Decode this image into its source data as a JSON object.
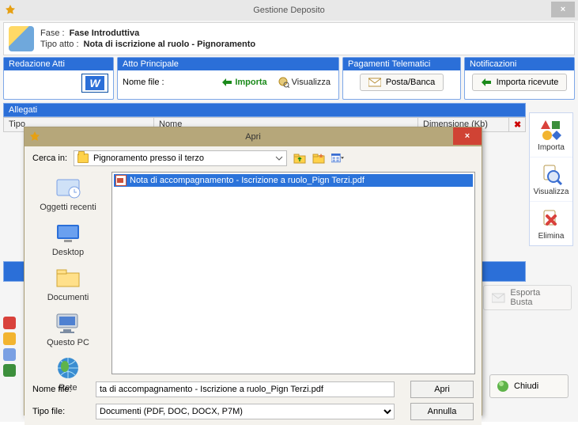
{
  "window": {
    "title": "Gestione Deposito",
    "close_glyph": "×"
  },
  "header": {
    "fase_label": "Fase :",
    "fase_value": "Fase Introduttiva",
    "tipo_label": "Tipo atto :",
    "tipo_value": "Nota di iscrizione al ruolo - Pignoramento"
  },
  "groups": {
    "redazione": {
      "title": "Redazione Atti"
    },
    "atto": {
      "title": "Atto Principale",
      "nome_file_label": "Nome file :",
      "importa_label": "Importa",
      "visualizza_label": "Visualizza"
    },
    "pagamenti": {
      "title": "Pagamenti Telematici",
      "button_label": "Posta/Banca"
    },
    "notificazioni": {
      "title": "Notificazioni",
      "button_label": "Importa ricevute"
    }
  },
  "allegati": {
    "section_title": "Allegati",
    "columns": {
      "tipo": "Tipo",
      "nome": "Nome",
      "dimensione": "Dimensione (Kb)",
      "del": "✖"
    }
  },
  "side": {
    "importa": "Importa",
    "visualizza": "Visualizza",
    "elimina": "Elimina"
  },
  "esporta_label": "Esporta Busta",
  "chiudi_label": "Chiudi",
  "dialog": {
    "title": "Apri",
    "close_glyph": "×",
    "cerca_label": "Cerca in:",
    "look_in_value": "Pignoramento presso il terzo",
    "places": {
      "recenti": "Oggetti recenti",
      "desktop": "Desktop",
      "documenti": "Documenti",
      "questopc": "Questo PC",
      "rete": "Rete"
    },
    "file_selected": "Nota di accompagnamento - Iscrizione a ruolo_Pign Terzi.pdf",
    "nome_file_label": "Nome file:",
    "nome_file_value": "ta di accompagnamento - Iscrizione a ruolo_Pign Terzi.pdf",
    "tipo_file_label": "Tipo file:",
    "tipo_file_value": "Documenti (PDF, DOC, DOCX, P7M)",
    "apri_btn": "Apri",
    "annulla_btn": "Annulla"
  },
  "colors": {
    "accent": "#2b6fd8",
    "dialog_title": "#b6a77a",
    "dialog_close": "#d04334"
  }
}
